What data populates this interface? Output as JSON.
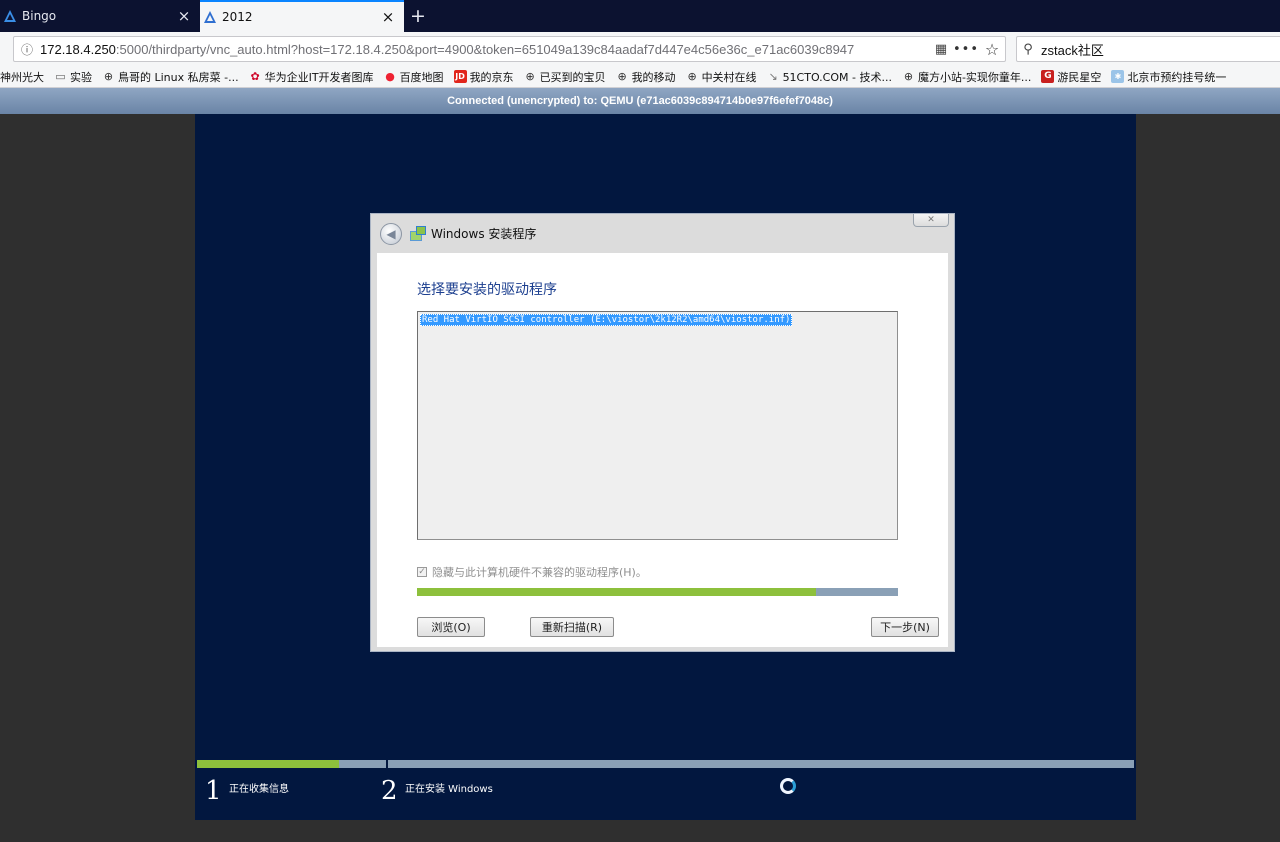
{
  "browser": {
    "tabs": [
      {
        "label": "Bingo",
        "active": false
      },
      {
        "label": "2012",
        "active": true
      }
    ],
    "url": {
      "host": "172.18.4.250",
      "rest": ":5000/thirdparty/vnc_auto.html?host=172.18.4.250&port=4900&token=651049a139c84aadaf7d447e4c56e36c_e71ac6039c8947"
    },
    "search_value": "zstack社区",
    "bookmarks": [
      {
        "label": "神州光大",
        "icon": "none"
      },
      {
        "label": "实验",
        "icon": "folder-icon"
      },
      {
        "label": "鳥哥的 Linux 私房菜 -...",
        "icon": "globe-icon"
      },
      {
        "label": "华为企业IT开发者图库",
        "icon": "huawei-icon"
      },
      {
        "label": "百度地图",
        "icon": "map-pin-icon"
      },
      {
        "label": "我的京东",
        "icon": "jd-icon"
      },
      {
        "label": "已买到的宝贝",
        "icon": "globe-icon"
      },
      {
        "label": "我的移动",
        "icon": "globe-icon"
      },
      {
        "label": "中关村在线",
        "icon": "globe-icon"
      },
      {
        "label": "51CTO.COM - 技术...",
        "icon": "tag-icon"
      },
      {
        "label": "魔方小站-实现你童年...",
        "icon": "globe-icon"
      },
      {
        "label": "游民星空",
        "icon": "gamersky-icon"
      },
      {
        "label": "北京市预约挂号统一",
        "icon": "bj-icon"
      }
    ]
  },
  "vnc": {
    "status": "Connected (unencrypted) to: QEMU (e71ac6039c894714b0e97f6efef7048c)"
  },
  "setup": {
    "title": "Windows 安装程序",
    "heading": "选择要安装的驱动程序",
    "driver_item": "Red Hat VirtIO SCSI controller (E:\\viostor\\2k12R2\\amd64\\viostor.inf)",
    "hide_incompatible_label": "隐藏与此计算机硬件不兼容的驱动程序(H)。",
    "hide_incompatible_checked": true,
    "progress": 0.83,
    "buttons": {
      "browse": "浏览(O)",
      "rescan": "重新扫描(R)",
      "next": "下一步(N)"
    }
  },
  "stages": [
    {
      "number": "1",
      "label": "正在收集信息"
    },
    {
      "number": "2",
      "label": "正在安装 Windows"
    }
  ],
  "colors": {
    "vm_background": "#02173f",
    "progress_fill": "#8dc03c",
    "progress_track": "#8aa0b6",
    "selection": "#3399ff",
    "heading": "#1c3f8f"
  }
}
